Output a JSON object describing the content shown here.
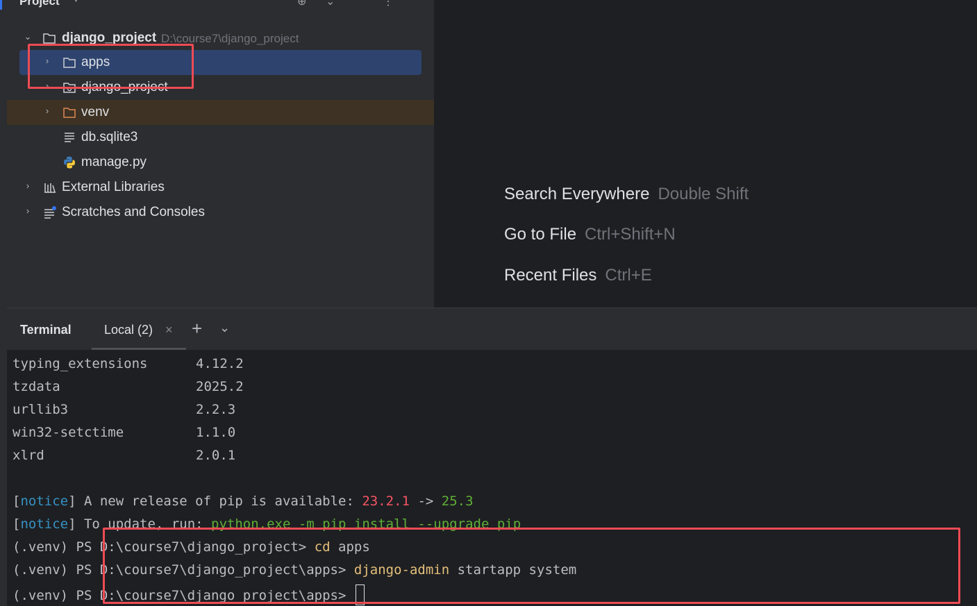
{
  "project_panel": {
    "title": "Project",
    "tree": {
      "root": {
        "name": "django_project",
        "path": "D:\\course7\\django_project"
      },
      "apps": "apps",
      "django_project": "django_project",
      "venv": "venv",
      "db": "db.sqlite3",
      "manage": "manage.py",
      "external": "External Libraries",
      "scratches": "Scratches and Consoles"
    }
  },
  "editor_hints": [
    {
      "action": "Search Everywhere",
      "shortcut": "Double Shift"
    },
    {
      "action": "Go to File",
      "shortcut": "Ctrl+Shift+N"
    },
    {
      "action": "Recent Files",
      "shortcut": "Ctrl+E"
    }
  ],
  "terminal": {
    "title": "Terminal",
    "tab": "Local (2)",
    "packages": [
      {
        "name": "typing_extensions",
        "version": "4.12.2"
      },
      {
        "name": "tzdata",
        "version": "2025.2"
      },
      {
        "name": "urllib3",
        "version": "2.2.3"
      },
      {
        "name": "win32-setctime",
        "version": "1.1.0"
      },
      {
        "name": "xlrd",
        "version": "2.0.1"
      }
    ],
    "notice1": {
      "tag": "notice",
      "text": " A new release of pip is available: ",
      "old": "23.2.1",
      "arrow": " -> ",
      "new": "25.3"
    },
    "notice2": {
      "tag": "notice",
      "text": " To update, run: ",
      "cmd": "python.exe -m pip install --upgrade pip"
    },
    "prompts": [
      {
        "prompt": "(.venv) PS D:\\course7\\django_project> ",
        "cmd": "cd",
        "args": " apps"
      },
      {
        "prompt": "(.venv) PS D:\\course7\\django_project\\apps> ",
        "cmd": "django-admin",
        "args": " startapp system"
      },
      {
        "prompt": "(.venv) PS D:\\course7\\django_project\\apps> ",
        "cmd": "",
        "args": ""
      }
    ]
  },
  "colors": {
    "selection": "#2e436e",
    "annotation_red": "#ee4b55",
    "notice_blue": "#3592c4",
    "version_red": "#f75464",
    "version_green": "#5fb036"
  }
}
